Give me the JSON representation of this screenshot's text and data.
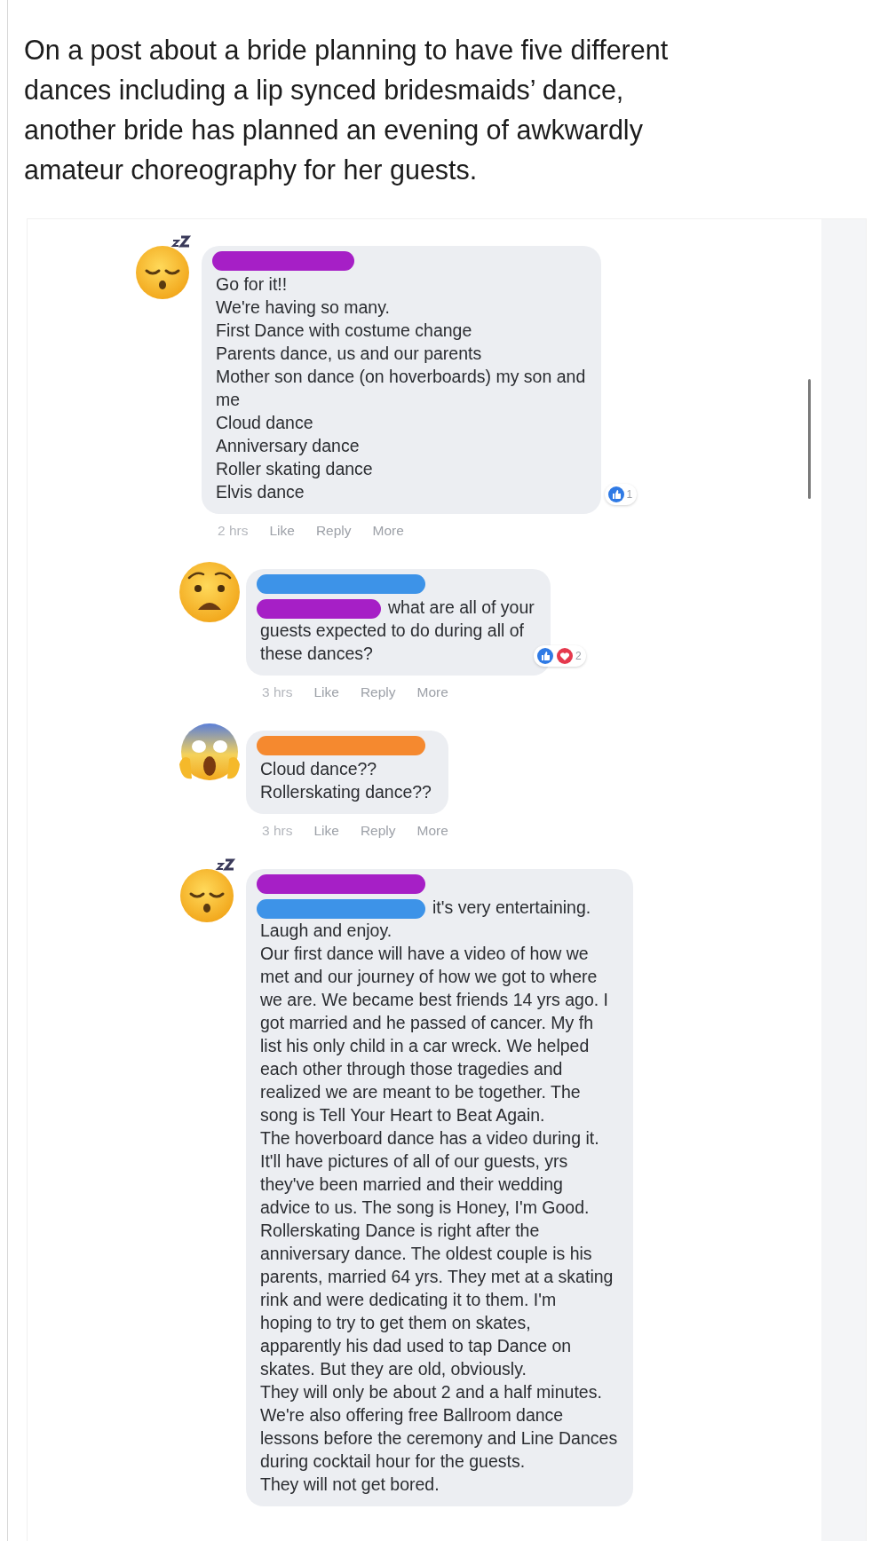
{
  "caption": "On a post about a bride planning to have five different\ndances including a lip synced bridesmaids’ dance,\nanother bride has planned an evening of awkwardly\namateur choreography for her guests.",
  "comments": [
    {
      "avatar": {
        "kind": "sleepy"
      },
      "name_redaction": {
        "color": "#a61fc6"
      },
      "text": "Go for it!!\nWe're having so many.\nFirst Dance with costume change\nParents dance, us and our parents\nMother son dance (on hoverboards) my son and\nme\nCloud dance\nAnniversary dance\nRoller skating dance\nElvis dance",
      "reactions": {
        "icons": [
          {
            "kind": "like"
          }
        ],
        "count": "1"
      },
      "meta": [
        "2 hrs",
        "Like",
        "Reply",
        "More"
      ],
      "replies": [
        {
          "avatar": {
            "kind": "fearful"
          },
          "name_redaction": {
            "color": "#3d93e8"
          },
          "inline_redaction": {
            "color": "#a61fc6"
          },
          "text": "what are all of your\nguests expected to do during all of\nthese dances?",
          "reactions": {
            "icons": [
              {
                "kind": "like"
              },
              {
                "kind": "love"
              }
            ],
            "count": "2"
          },
          "meta": [
            "3 hrs",
            "Like",
            "Reply",
            "More"
          ]
        },
        {
          "avatar": {
            "kind": "scream"
          },
          "name_redaction": {
            "color": "#f5892f"
          },
          "text": "Cloud dance??\nRollerskating dance??",
          "meta": [
            "3 hrs",
            "Like",
            "Reply",
            "More"
          ]
        },
        {
          "avatar": {
            "kind": "sleepy"
          },
          "name_redaction": {
            "color": "#a61fc6"
          },
          "inline_redaction": {
            "color": "#3d93e8"
          },
          "text": "it's very entertaining.\nLaugh and enjoy.\nOur first dance will have a video of how we\nmet and our journey of how we got to where\nwe are. We became best friends 14 yrs ago. I\ngot married and he passed of cancer. My fh\nlist his only child in a car wreck. We helped\neach other through those tragedies and\nrealized we are meant to be together. The\nsong is Tell Your Heart to Beat Again.\nThe hoverboard dance has a video during it.\nIt'll have pictures of all of our guests, yrs\nthey've been married and their wedding\nadvice to us. The song is Honey, I'm Good.\nRollerskating Dance is right after the\nanniversary dance. The oldest couple is his\nparents, married 64 yrs. They met at a skating\nrink and were dedicating it to them. I'm\nhoping to try to get them on skates,\napparently his dad used to tap Dance on\nskates. But they are old, obviously.\nThey will only be about 2 and a half minutes.\nWe're also offering free Ballroom dance\nlessons before the ceremony and Line Dances\nduring cocktail hour for the guests.\nThey will not get bored."
        }
      ]
    }
  ]
}
